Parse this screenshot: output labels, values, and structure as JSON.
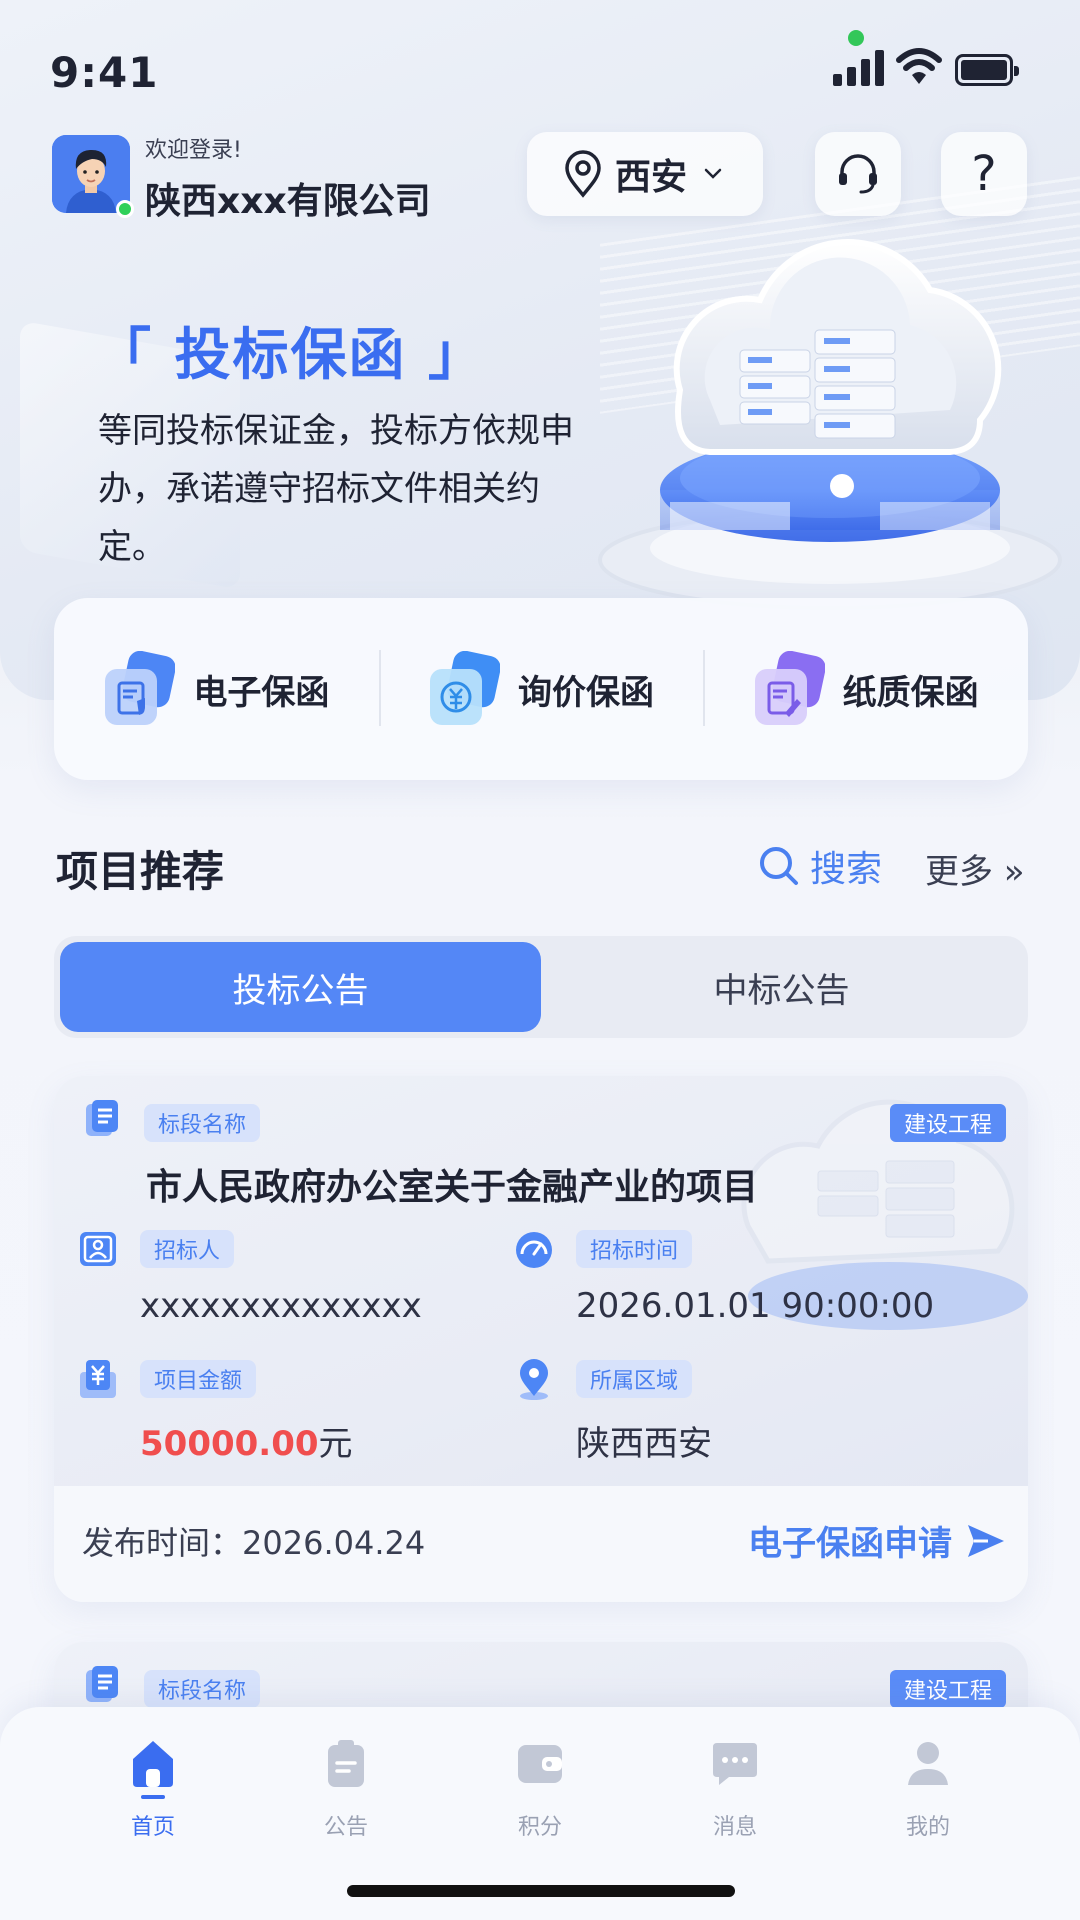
{
  "status_bar": {
    "time": "9:41"
  },
  "header": {
    "welcome": "欢迎登录!",
    "company": "陕西xxx有限公司",
    "location": "西安",
    "help_label": "?"
  },
  "hero": {
    "title": "「 投标保函 」",
    "description": "等同投标保证金，投标方依规申办，承诺遵守招标文件相关约定。"
  },
  "quick_actions": [
    {
      "label": "电子保函",
      "icon": "shield-document-icon"
    },
    {
      "label": "询价保函",
      "icon": "yuan-coin-icon"
    },
    {
      "label": "纸质保函",
      "icon": "paper-edit-icon"
    }
  ],
  "section": {
    "title": "项目推荐",
    "search": "搜索",
    "more": "更多 »"
  },
  "tabs": [
    {
      "label": "投标公告",
      "active": true
    },
    {
      "label": "中标公告",
      "active": false
    }
  ],
  "projects": [
    {
      "section_label": "标段名称",
      "tag": "建设工程",
      "name": "市人民政府办公室关于金融产业的项目",
      "tenderer_label": "招标人",
      "tenderer": "xxxxxxxxxxxxxx",
      "time_label": "招标时间",
      "time": "2026.01.01 90:00:00",
      "amount_label": "项目金额",
      "amount": "50000.00",
      "amount_unit": "元",
      "region_label": "所属区域",
      "region": "陕西西安",
      "publish": "发布时间：2026.04.24",
      "action": "电子保函申请"
    },
    {
      "section_label": "标段名称",
      "tag": "建设工程"
    }
  ],
  "nav": [
    {
      "label": "首页",
      "icon": "home-icon",
      "active": true
    },
    {
      "label": "公告",
      "icon": "clipboard-icon",
      "active": false
    },
    {
      "label": "积分",
      "icon": "wallet-icon",
      "active": false
    },
    {
      "label": "消息",
      "icon": "message-icon",
      "active": false
    },
    {
      "label": "我的",
      "icon": "user-icon",
      "active": false
    }
  ],
  "colors": {
    "accent": "#4a80f0",
    "tab_active": "#5487f6",
    "amount": "#f04e4e",
    "tag": "#5a8cf7"
  }
}
